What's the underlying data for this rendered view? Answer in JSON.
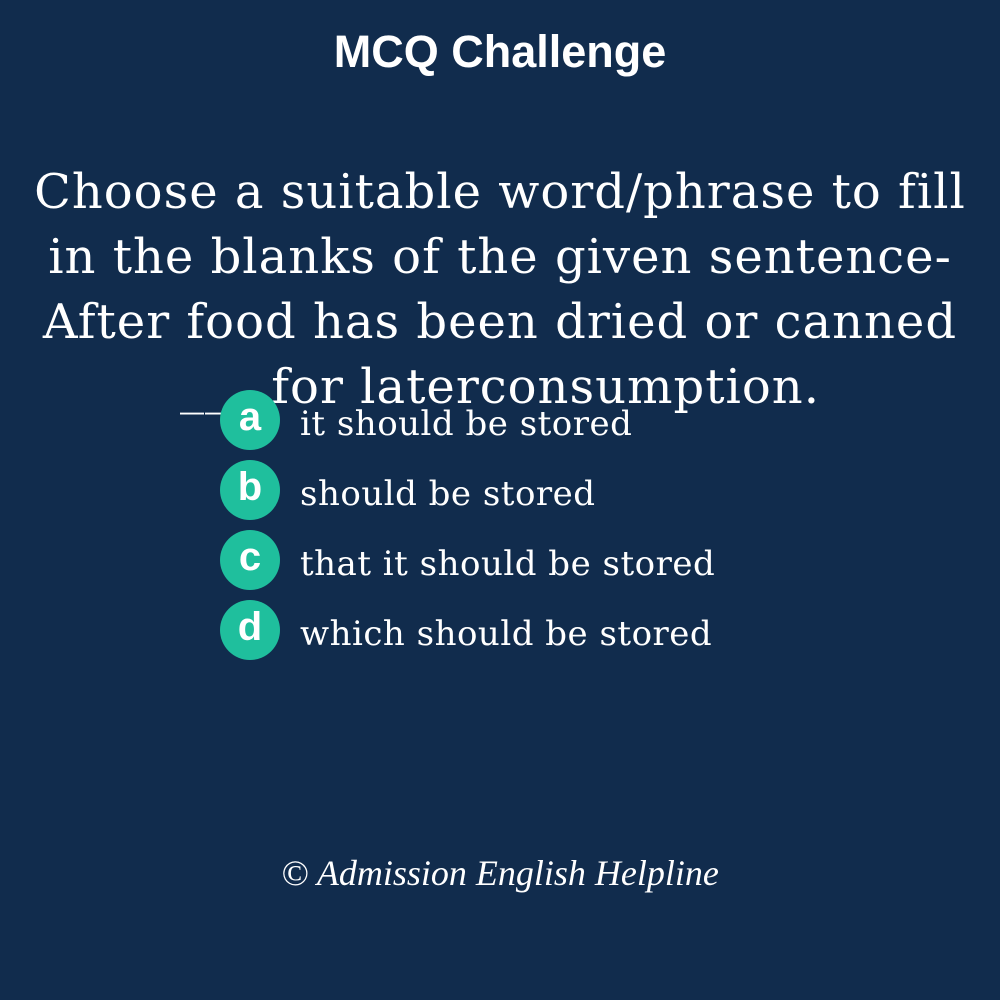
{
  "header": {
    "title": "MCQ Challenge"
  },
  "question": {
    "lines": [
      "Choose a suitable word/phrase to fill",
      "in the blanks of the given sentence-",
      "After food has been dried or canned",
      "___ for laterconsumption."
    ]
  },
  "options": [
    {
      "letter": "a",
      "text": "it should be stored"
    },
    {
      "letter": "b",
      "text": "should be stored"
    },
    {
      "letter": "c",
      "text": "that it should be stored"
    },
    {
      "letter": "d",
      "text": "which should be stored"
    }
  ],
  "footer": {
    "copyright": "© Admission English Helpline"
  },
  "colors": {
    "background": "#112c4d",
    "badge": "#1fbf9d",
    "text": "#ffffff"
  }
}
